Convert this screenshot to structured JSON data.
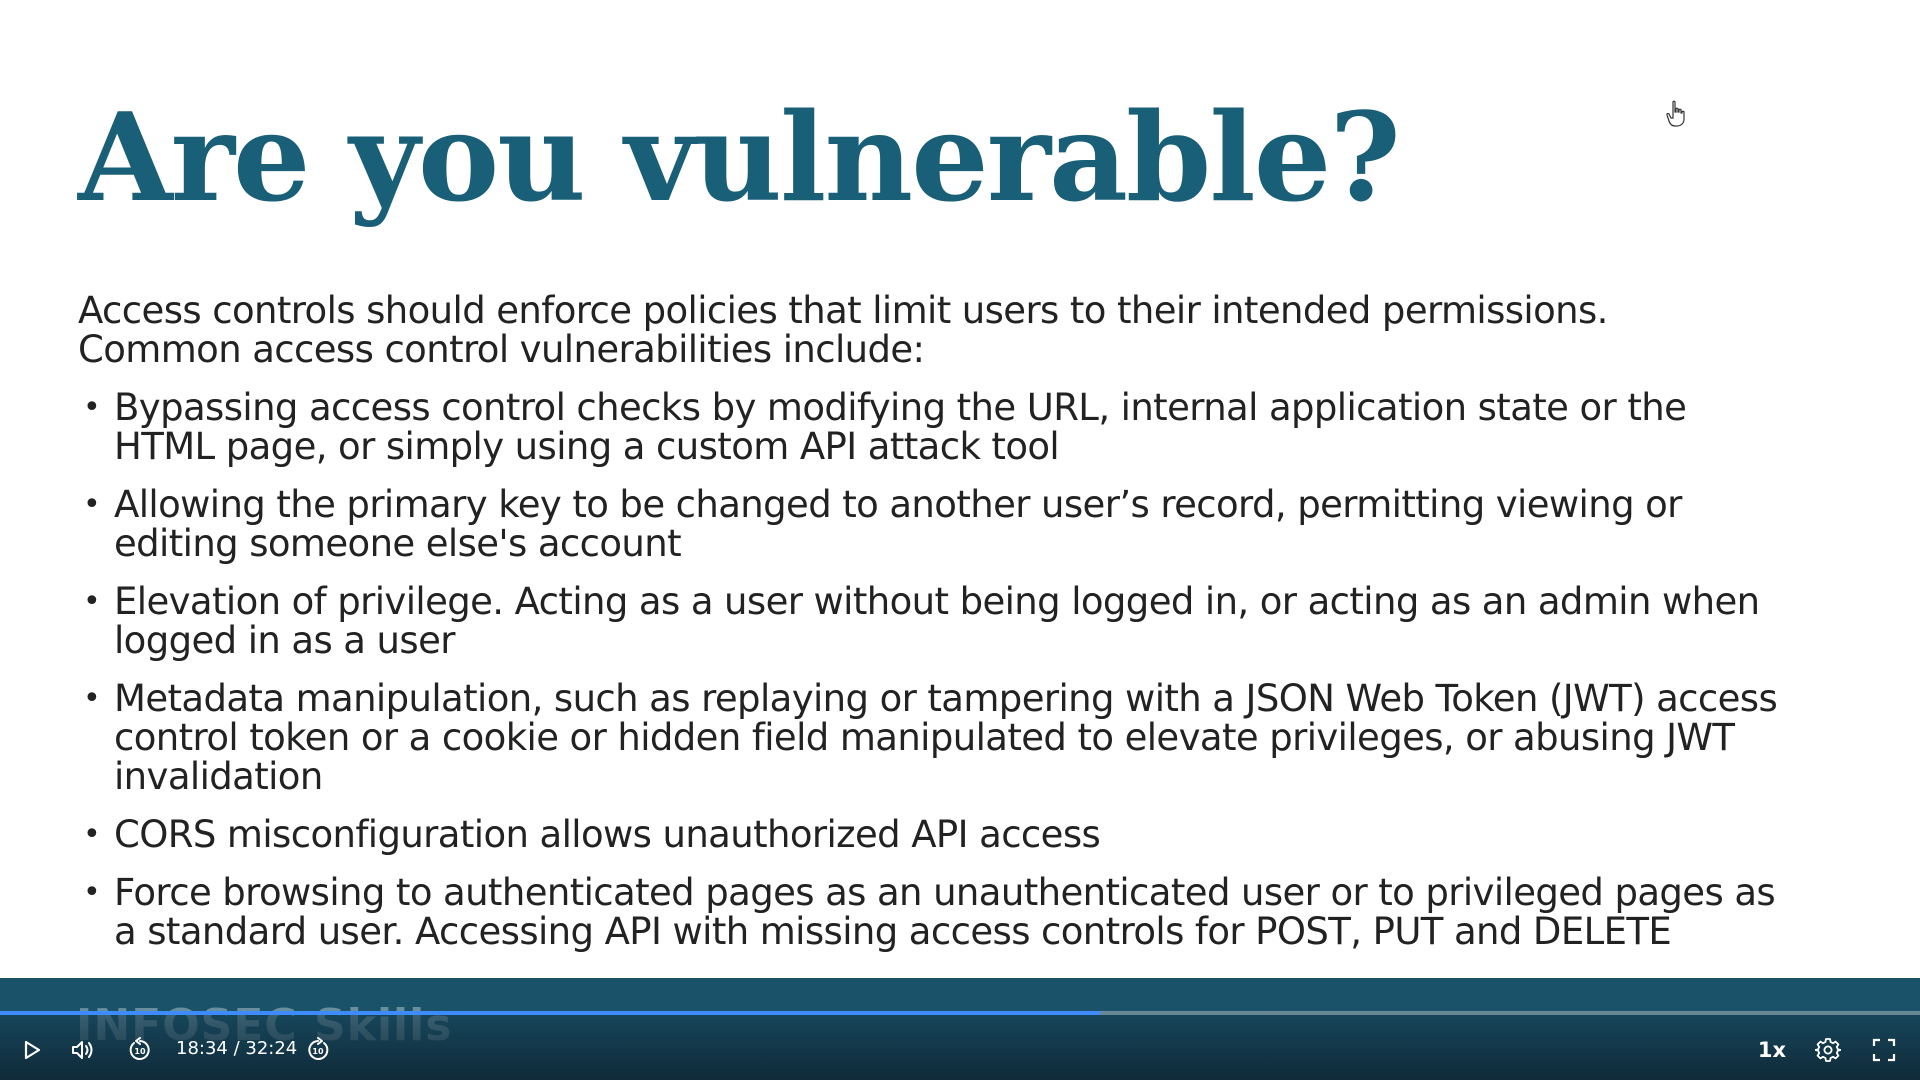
{
  "slide": {
    "title": "Are you vulnerable?",
    "intro_lines": [
      "Access controls should enforce policies that limit users to their intended permissions.",
      "Common access control vulnerabilities include:"
    ],
    "bullets": [
      {
        "lines": [
          "Bypassing access control checks by modifying the URL, internal application state or the",
          "HTML page, or simply using a custom API attack tool"
        ]
      },
      {
        "lines": [
          "Allowing the primary key to be changed to another user’s record, permitting viewing or",
          "editing someone else's account"
        ]
      },
      {
        "lines": [
          "Elevation of privilege. Acting as a user without being logged in, or acting as an admin when",
          "logged in as a user"
        ]
      },
      {
        "lines": [
          "Metadata manipulation, such as replaying or tampering with a JSON Web Token (JWT) access",
          "control token or a cookie or hidden field manipulated to elevate privileges, or abusing JWT",
          "invalidation"
        ]
      },
      {
        "lines": [
          "CORS misconfiguration allows unauthorized API access"
        ]
      },
      {
        "lines": [
          "Force browsing to authenticated pages as an unauthenticated user or to privileged pages as",
          "a standard user. Accessing API with missing access controls for POST, PUT and DELETE"
        ]
      }
    ],
    "bullet_glyph": "•"
  },
  "watermark": "INFOSEC Skills",
  "player": {
    "current_time": "18:34",
    "separator": " / ",
    "duration": "32:24",
    "progress_fraction": 0.573,
    "speed_label": "1x",
    "icons": {
      "play": "play-icon",
      "volume": "volume-icon",
      "rewind": "rewind-10-icon",
      "forward": "forward-10-icon",
      "settings": "gear-icon",
      "fullscreen": "fullscreen-icon",
      "cursor": "hand-cursor-icon"
    }
  },
  "colors": {
    "title": "#1a5f78",
    "text": "#222222",
    "band": "#1a5369",
    "progress": "#3d8bff"
  }
}
